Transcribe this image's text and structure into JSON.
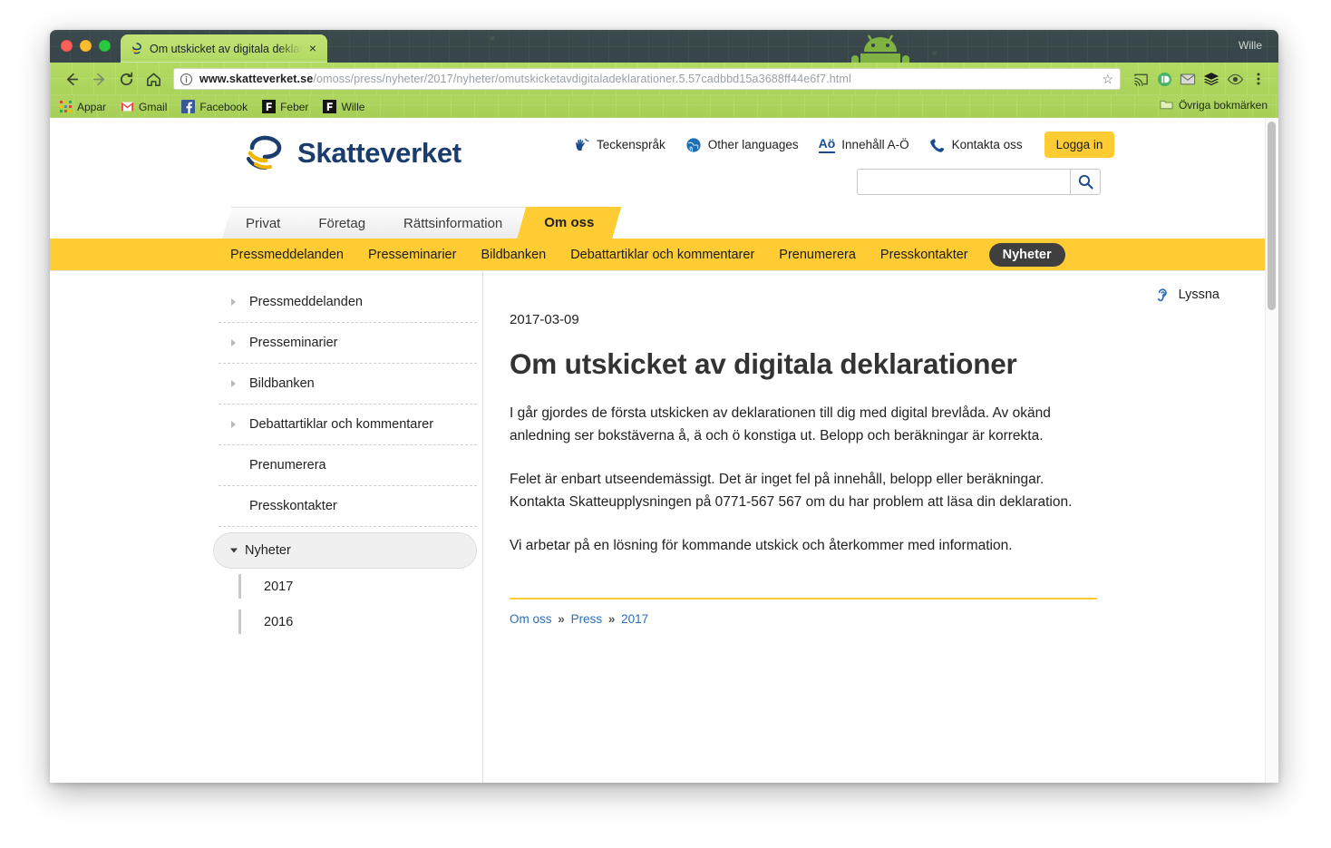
{
  "browser": {
    "profile_name": "Wille",
    "tab": {
      "title": "Om utskicket av digitala deklar",
      "close_label": "×",
      "favicon_name": "skatteverket-favicon"
    },
    "toolbar": {
      "back_label": "←",
      "forward_label": "→",
      "reload_label": "↻",
      "home_label": "⌂",
      "url_scheme_host": "www.skatteverket.se",
      "url_path": "/omoss/press/nyheter/2017/nyheter/omutskicketavdigitaladeklarationer.5.57cadbbd15a3688ff44e6f7.html",
      "star_label": "☆",
      "security_icon": "info-circle-icon"
    },
    "bookmarks": [
      {
        "label": "Appar",
        "icon": "apps-grid-icon"
      },
      {
        "label": "Gmail",
        "icon": "gmail-icon"
      },
      {
        "label": "Facebook",
        "icon": "facebook-icon"
      },
      {
        "label": "Feber",
        "icon": "feber-icon"
      },
      {
        "label": "Wille",
        "icon": "feber-icon"
      }
    ],
    "other_bookmarks": "Övriga bokmärken"
  },
  "site": {
    "logo_text": "Skatteverket",
    "util_links": [
      {
        "label": "Teckenspråk",
        "icon": "sign-language-icon"
      },
      {
        "label": "Other languages",
        "icon": "globe-icon"
      },
      {
        "label": "Innehåll A-Ö",
        "icon": "a-to-o-icon"
      },
      {
        "label": "Kontakta oss",
        "icon": "phone-icon"
      }
    ],
    "login_label": "Logga in",
    "search": {
      "value": "",
      "placeholder": "",
      "button_icon": "search-icon"
    },
    "primary_tabs": [
      {
        "label": "Privat",
        "active": false
      },
      {
        "label": "Företag",
        "active": false
      },
      {
        "label": "Rättsinformation",
        "active": false
      },
      {
        "label": "Om oss",
        "active": true
      }
    ],
    "subnav": [
      {
        "label": "Pressmeddelanden",
        "active": false
      },
      {
        "label": "Presseminarier",
        "active": false
      },
      {
        "label": "Bildbanken",
        "active": false
      },
      {
        "label": "Debattartiklar och kommentarer",
        "active": false
      },
      {
        "label": "Prenumerera",
        "active": false
      },
      {
        "label": "Presskontakter",
        "active": false
      },
      {
        "label": "Nyheter",
        "active": true
      }
    ]
  },
  "sidebar": {
    "items": [
      {
        "label": "Pressmeddelanden",
        "caret": true,
        "active": false
      },
      {
        "label": "Presseminarier",
        "caret": true,
        "active": false
      },
      {
        "label": "Bildbanken",
        "caret": true,
        "active": false
      },
      {
        "label": "Debattartiklar och kommentarer",
        "caret": true,
        "active": false
      },
      {
        "label": "Prenumerera",
        "caret": false,
        "active": false
      },
      {
        "label": "Presskontakter",
        "caret": false,
        "active": false
      },
      {
        "label": "Nyheter",
        "caret": true,
        "active": true
      }
    ],
    "sub_items": [
      {
        "label": "2017"
      },
      {
        "label": "2016"
      }
    ]
  },
  "article": {
    "listen_label": "Lyssna",
    "listen_icon": "ear-icon",
    "date": "2017-03-09",
    "title": "Om utskicket av digitala deklarationer",
    "paragraphs": [
      "I går gjordes de första utskicken av deklarationen till dig med digital brevlåda. Av okänd anledning ser bokstäverna å, ä och ö konstiga ut. Belopp och beräkningar är korrekta.",
      "Felet är enbart utseendemässigt. Det är inget fel på innehåll, belopp eller beräkningar. Kontakta Skatteupplysningen på 0771-567 567 om du har problem att läsa din deklaration.",
      "Vi arbetar på en lösning för kommande utskick och återkommer med information."
    ],
    "breadcrumb": [
      {
        "label": "Om oss"
      },
      {
        "label": "Press"
      },
      {
        "label": "2017"
      }
    ],
    "breadcrumb_separator": "»"
  },
  "colors": {
    "brand_yellow": "#ffcc33",
    "brand_blue": "#1b3d6d",
    "link_blue": "#2a6ebb",
    "active_pill": "#3f3f3f"
  }
}
